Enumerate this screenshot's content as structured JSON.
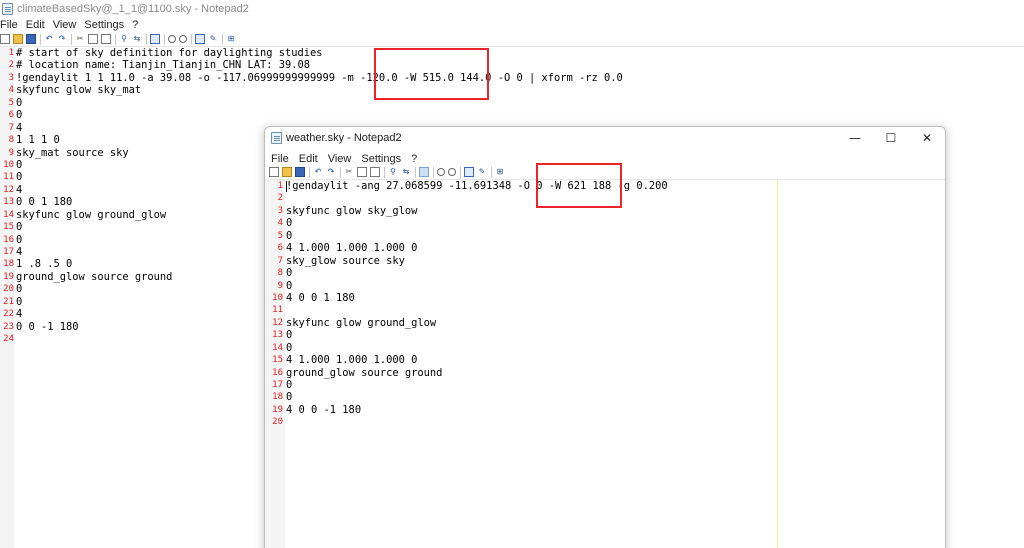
{
  "back_window": {
    "title": "climateBasedSky@_1_1@1100.sky - Notepad2",
    "menu": [
      "File",
      "Edit",
      "View",
      "Settings",
      "?"
    ],
    "lines": [
      {
        "n": "1",
        "t": "# start of sky definition for daylighting studies"
      },
      {
        "n": "2",
        "t": "# location name: Tianjin_Tianjin_CHN LAT: 39.08"
      },
      {
        "n": "3",
        "t": "!gendaylit 1 1 11.0 -a 39.08 -o -117.06999999999999 -m -120.0 -W 515.0 144.0 -O 0 | xform -rz 0.0"
      },
      {
        "n": "4",
        "t": "skyfunc glow sky_mat"
      },
      {
        "n": "5",
        "t": "0"
      },
      {
        "n": "6",
        "t": "0"
      },
      {
        "n": "7",
        "t": "4"
      },
      {
        "n": "8",
        "t": "1 1 1 0"
      },
      {
        "n": "9",
        "t": "sky_mat source sky"
      },
      {
        "n": "10",
        "t": "0"
      },
      {
        "n": "11",
        "t": "0"
      },
      {
        "n": "12",
        "t": "4"
      },
      {
        "n": "13",
        "t": "0 0 1 180"
      },
      {
        "n": "14",
        "t": "skyfunc glow ground_glow"
      },
      {
        "n": "15",
        "t": "0"
      },
      {
        "n": "16",
        "t": "0"
      },
      {
        "n": "17",
        "t": "4"
      },
      {
        "n": "18",
        "t": "1 .8 .5 0"
      },
      {
        "n": "19",
        "t": "ground_glow source ground"
      },
      {
        "n": "20",
        "t": "0"
      },
      {
        "n": "21",
        "t": "0"
      },
      {
        "n": "22",
        "t": "4"
      },
      {
        "n": "23",
        "t": "0 0 -1 180"
      },
      {
        "n": "24",
        "t": ""
      }
    ]
  },
  "front_window": {
    "title": "weather.sky - Notepad2",
    "menu": [
      "File",
      "Edit",
      "View",
      "Settings",
      "?"
    ],
    "caption": {
      "minimize": "—",
      "maximize": "☐",
      "close": "✕"
    },
    "lines": [
      {
        "n": "1",
        "t": "!gendaylit -ang 27.068599 -11.691348 -O 0 -W 621 188 -g 0.200"
      },
      {
        "n": "2",
        "t": ""
      },
      {
        "n": "3",
        "t": "skyfunc glow sky_glow"
      },
      {
        "n": "4",
        "t": "0"
      },
      {
        "n": "5",
        "t": "0"
      },
      {
        "n": "6",
        "t": "4 1.000 1.000 1.000 0"
      },
      {
        "n": "7",
        "t": "sky_glow source sky"
      },
      {
        "n": "8",
        "t": "0"
      },
      {
        "n": "9",
        "t": "0"
      },
      {
        "n": "10",
        "t": "4 0 0 1 180"
      },
      {
        "n": "11",
        "t": ""
      },
      {
        "n": "12",
        "t": "skyfunc glow ground_glow"
      },
      {
        "n": "13",
        "t": "0"
      },
      {
        "n": "14",
        "t": "0"
      },
      {
        "n": "15",
        "t": "4 1.000 1.000 1.000 0"
      },
      {
        "n": "16",
        "t": "ground_glow source ground"
      },
      {
        "n": "17",
        "t": "0"
      },
      {
        "n": "18",
        "t": "0"
      },
      {
        "n": "19",
        "t": "4 0 0 -1 180"
      },
      {
        "n": "20",
        "t": ""
      }
    ]
  },
  "colors": {
    "line_number": "#e02020",
    "highlight_box": "#e8262a",
    "long_line_marker": "#f1e7a3"
  },
  "icons": [
    "new-file-icon",
    "open-file-icon",
    "save-icon",
    "undo-icon",
    "redo-icon",
    "cut-icon",
    "copy-icon",
    "paste-icon",
    "find-icon",
    "replace-icon",
    "word-wrap-icon",
    "zoom-in-icon",
    "zoom-out-icon",
    "scheme-icon",
    "settings-icon",
    "window-icon"
  ]
}
